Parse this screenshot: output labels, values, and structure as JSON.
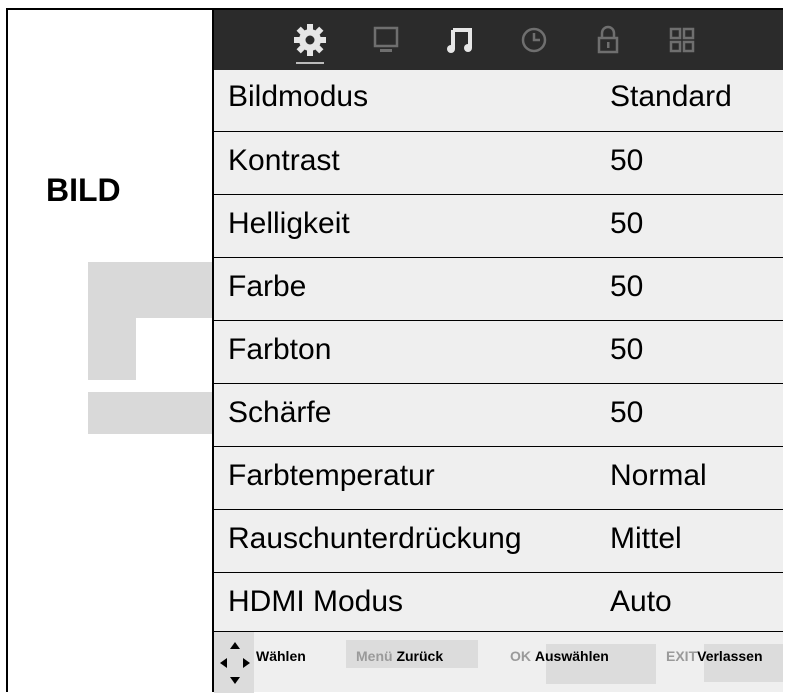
{
  "page_title": "BILD",
  "tabs": [
    {
      "icon": "gear-icon",
      "active": true
    },
    {
      "icon": "monitor-icon",
      "active": false
    },
    {
      "icon": "music-note-icon",
      "active": false
    },
    {
      "icon": "clock-icon",
      "active": false
    },
    {
      "icon": "lock-icon",
      "active": false
    },
    {
      "icon": "grid-icon",
      "active": false
    }
  ],
  "menu": {
    "items": [
      {
        "label": "Bildmodus",
        "value": "Standard"
      },
      {
        "label": "Kontrast",
        "value": "50"
      },
      {
        "label": "Helligkeit",
        "value": "50"
      },
      {
        "label": "Farbe",
        "value": "50"
      },
      {
        "label": "Farbton",
        "value": "50"
      },
      {
        "label": "Schärfe",
        "value": "50"
      },
      {
        "label": "Farbtemperatur",
        "value": "Normal"
      },
      {
        "label": "Rauschunterdrückung",
        "value": "Mittel"
      },
      {
        "label": "HDMI Modus",
        "value": "Auto"
      }
    ]
  },
  "footer": {
    "select": {
      "text": "Wählen"
    },
    "back": {
      "key": "Menü",
      "text": "Zurück"
    },
    "ok": {
      "key": "OK",
      "text": "Auswählen"
    },
    "exit": {
      "key": "EXIT",
      "text": "Verlassen"
    }
  },
  "colors": {
    "topbar": "#2b2b2b",
    "menu_bg": "#efefef",
    "deco": "#d9d9d9",
    "key_gray": "#9a9a9a"
  }
}
